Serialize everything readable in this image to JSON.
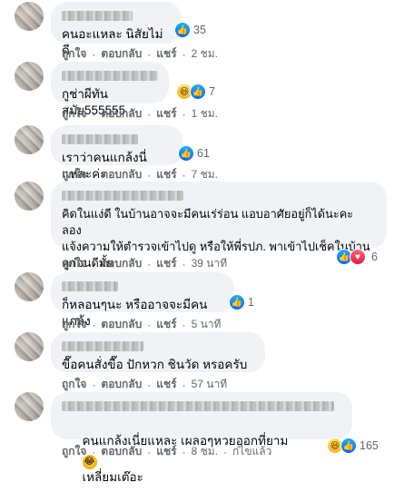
{
  "comments": [
    {
      "text": "คนอะแหละ นิสัยไม่ดี",
      "reaction_count": "35",
      "reactions": [
        "like"
      ],
      "time": "2 ชม.",
      "edited": ""
    },
    {
      "text": "กูช่าผีทันสมัย555555",
      "reaction_count": "7",
      "reactions": [
        "haha",
        "like"
      ],
      "time": "1 ชม.",
      "edited": ""
    },
    {
      "text": "เราว่าคนแกล้งนี่แหละค่ะ",
      "reaction_count": "61",
      "reactions": [
        "like"
      ],
      "time": "7 ชม.",
      "edited": ""
    },
    {
      "text": "คิดในแง่ดี ในบ้านอาจจะมีคนเร่ร่อน แอบอาศัยอยู่ก็ได้นะคะ ลอง\nแจ้งความให้ตำรวจเข้าไปดู หรือให้พี่รปภ. พาเข้าไปเช็คในบ้าน\nดูก่อนดีมั้ย",
      "reaction_count": "6",
      "reactions": [
        "like",
        "love"
      ],
      "time": "39 นาที",
      "edited": ""
    },
    {
      "text": "ก็หลอนๆนะ หรืออาจจะมีคนแกล้ง",
      "reaction_count": "1",
      "reactions": [
        "like"
      ],
      "time": "5 นาที",
      "edited": ""
    },
    {
      "text": "ขื๊อคนสั่งขื๊อ ปักหวก ชินวัด หรอครับ",
      "reaction_count": "",
      "reactions": [],
      "time": "57 นาที",
      "edited": ""
    },
    {
      "text": "คนแกล้งเนี่ยแหละ เผลอๆหวยออกที่ยาม",
      "text_tail": "เหลี่ยมเต๊อะ",
      "reaction_count": "165",
      "reactions": [
        "haha",
        "like"
      ],
      "time": "8 ชม.",
      "edited": "ก่ไขแล้ว"
    }
  ],
  "labels": {
    "like": "ถูกใจ",
    "reply": "ตอบกลับ",
    "share": "แชร์"
  },
  "colors": {
    "bubble": "#f0f2f5",
    "meta": "#65676b",
    "like": "#0866ff"
  }
}
